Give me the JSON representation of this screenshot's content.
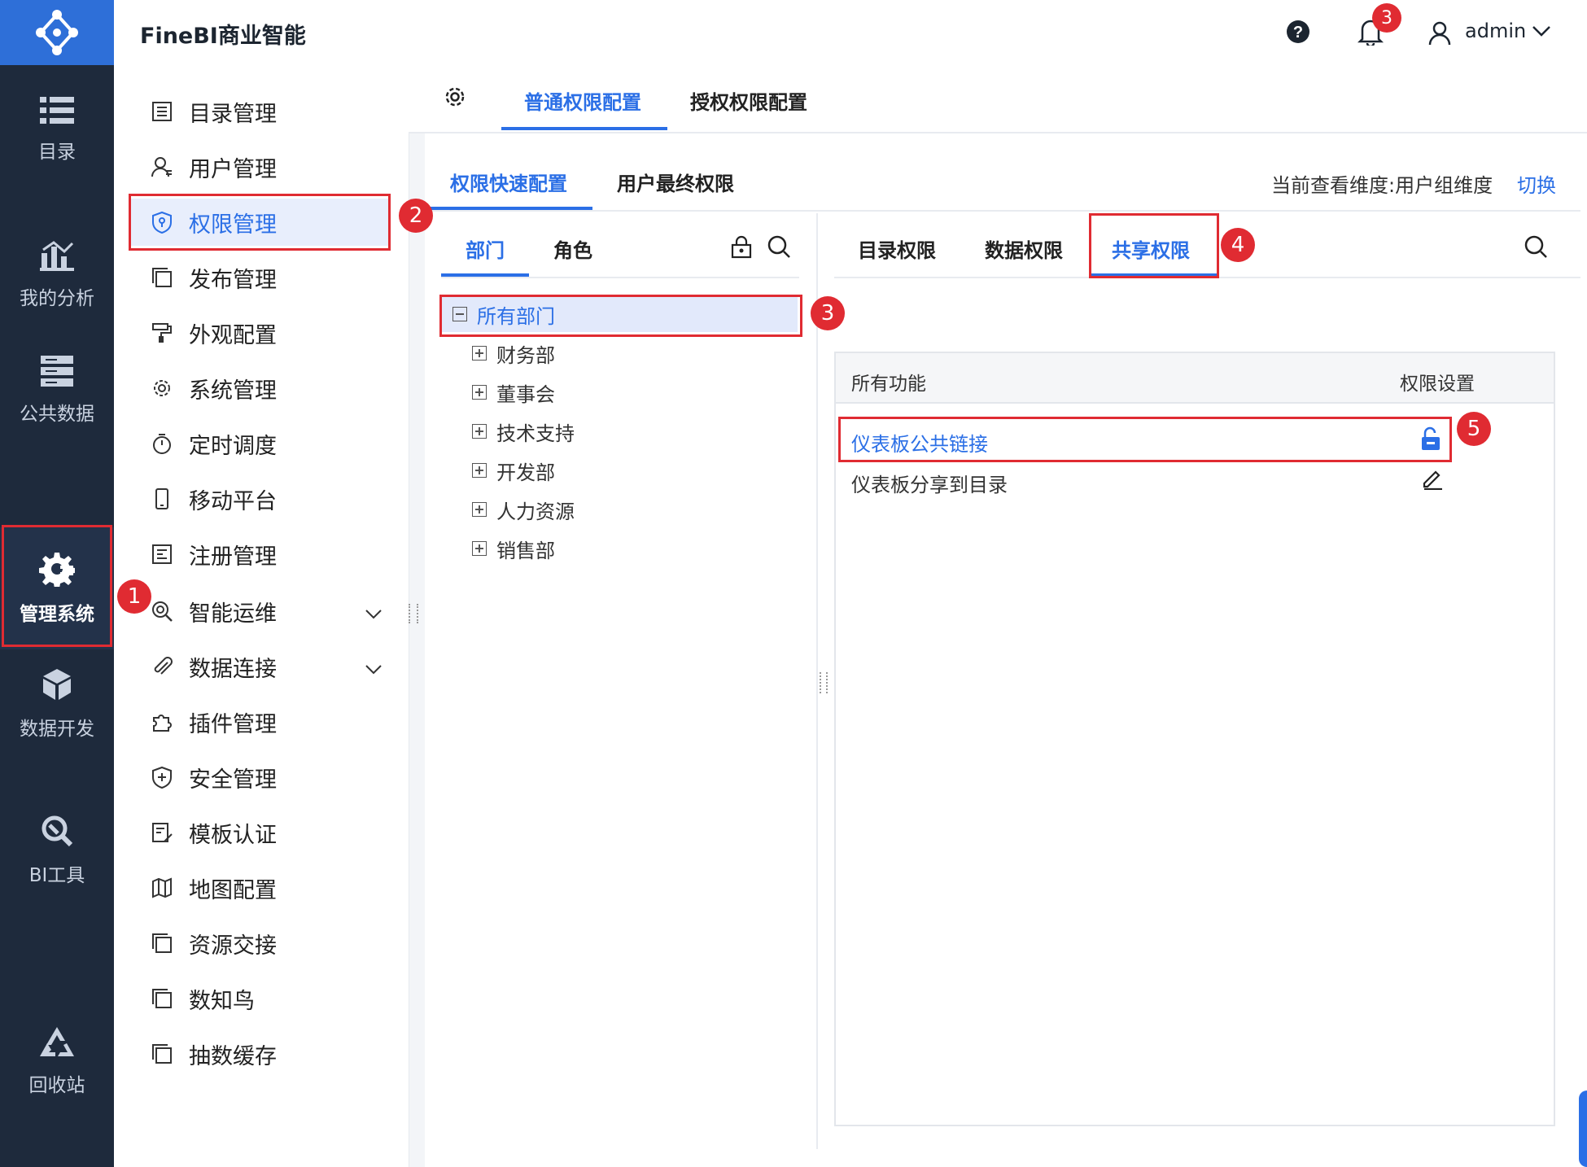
{
  "app": {
    "title": "FineBI商业智能"
  },
  "header": {
    "user": "admin",
    "notification_count": "3"
  },
  "rail": {
    "items": [
      {
        "label": "目录",
        "icon": "list-icon"
      },
      {
        "label": "我的分析",
        "icon": "chart-icon"
      },
      {
        "label": "公共数据",
        "icon": "database-icon"
      },
      {
        "label": "管理系统",
        "icon": "gear-icon",
        "active": true
      },
      {
        "label": "数据开发",
        "icon": "cube-icon"
      },
      {
        "label": "BI工具",
        "icon": "wrench-icon"
      },
      {
        "label": "回收站",
        "icon": "recycle-icon"
      }
    ]
  },
  "sidebar": {
    "items": [
      {
        "label": "目录管理"
      },
      {
        "label": "用户管理"
      },
      {
        "label": "权限管理",
        "active": true
      },
      {
        "label": "发布管理"
      },
      {
        "label": "外观配置"
      },
      {
        "label": "系统管理"
      },
      {
        "label": "定时调度"
      },
      {
        "label": "移动平台"
      },
      {
        "label": "注册管理"
      },
      {
        "label": "智能运维"
      },
      {
        "label": "数据连接"
      },
      {
        "label": "插件管理"
      },
      {
        "label": "安全管理"
      },
      {
        "label": "模板认证"
      },
      {
        "label": "地图配置"
      },
      {
        "label": "资源交接"
      },
      {
        "label": "数知鸟"
      },
      {
        "label": "抽数缓存"
      }
    ]
  },
  "top_tabs": {
    "normal": "普通权限配置",
    "auth": "授权权限配置"
  },
  "sub_tabs": {
    "quick": "权限快速配置",
    "final": "用户最终权限",
    "dimension": "当前查看维度:用户组维度",
    "switch": "切换"
  },
  "left_tabs": {
    "dept": "部门",
    "role": "角色"
  },
  "tree": {
    "root": "所有部门",
    "children": [
      "财务部",
      "董事会",
      "技术支持",
      "开发部",
      "人力资源",
      "销售部"
    ]
  },
  "right_tabs": {
    "catalog": "目录权限",
    "data": "数据权限",
    "share": "共享权限"
  },
  "table": {
    "col_function": "所有功能",
    "col_setting": "权限设置",
    "rows": [
      {
        "name": "仪表板公共链接"
      },
      {
        "name": "仪表板分享到目录"
      }
    ]
  },
  "annotations": [
    "1",
    "2",
    "3",
    "4",
    "5"
  ],
  "colors": {
    "accent": "#2b6fe6",
    "rail_bg": "#1e2a3c",
    "logo_bg": "#2e6fd8",
    "highlight": "#e02b32"
  }
}
